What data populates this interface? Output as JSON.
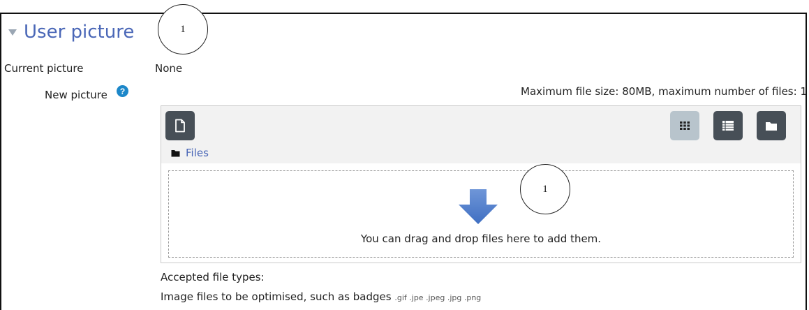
{
  "section": {
    "title": "User picture"
  },
  "annotations": {
    "top": "1",
    "dropzone": "1"
  },
  "current_picture": {
    "label": "Current picture",
    "value": "None"
  },
  "new_picture": {
    "label": "New picture",
    "help_icon": "question-circle-icon",
    "help_glyph": "?"
  },
  "filepicker": {
    "max_info": "Maximum file size: 80MB, maximum number of files: 1",
    "add_file_icon": "file-icon",
    "view_icons": [
      "grid-icon",
      "list-icon",
      "folder-icon"
    ],
    "breadcrumb": "Files",
    "drop_text": "You can drag and drop files here to add them."
  },
  "accepted": {
    "title": "Accepted file types:",
    "description": "Image files to be optimised, such as badges",
    "extensions": ".gif .jpe .jpeg .jpg .png"
  },
  "colors": {
    "link": "#4a67b7",
    "button": "#474f57",
    "button_active": "#b8c4cc",
    "help": "#1c87c9",
    "arrow": "#4a78c8"
  }
}
